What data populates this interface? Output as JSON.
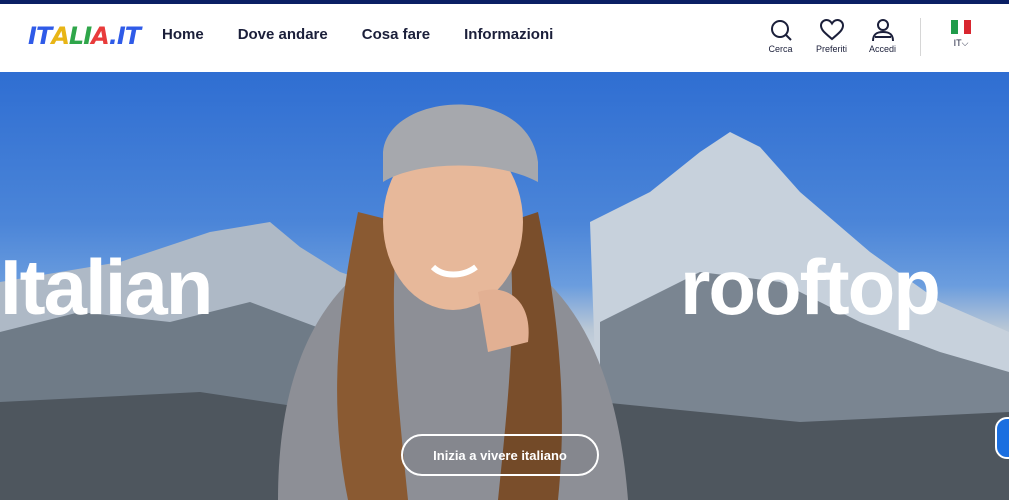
{
  "brand": {
    "logo_text": "ITALIA.IT",
    "letters": [
      "I",
      "T",
      "A",
      "L",
      "I",
      "A",
      ".",
      "I",
      "T"
    ],
    "letter_colors": [
      "#2f5be8",
      "#2f5be8",
      "#e8b516",
      "#2fa64a",
      "#2fa64a",
      "#e83b3b",
      "#2f5be8",
      "#2f5be8",
      "#2f5be8"
    ]
  },
  "nav": {
    "items": [
      "Home",
      "Dove andare",
      "Cosa fare",
      "Informazioni"
    ]
  },
  "actions": {
    "search": {
      "label": "Cerca",
      "icon": "search-icon"
    },
    "favorites": {
      "label": "Preferiti",
      "icon": "heart-icon"
    },
    "login": {
      "label": "Accedi",
      "icon": "user-icon"
    }
  },
  "language": {
    "label": "IT",
    "chevron": "⌵",
    "flag_colors": [
      "#1f9b4a",
      "#ffffff",
      "#d8262f"
    ]
  },
  "hero": {
    "word_left": "Italian",
    "word_right": "rooftop",
    "cta_label": "Inizia a vivere italiano"
  },
  "colors": {
    "topline": "#0a1f64",
    "text": "#1b1f3a",
    "accent": "#1b6fe0"
  }
}
